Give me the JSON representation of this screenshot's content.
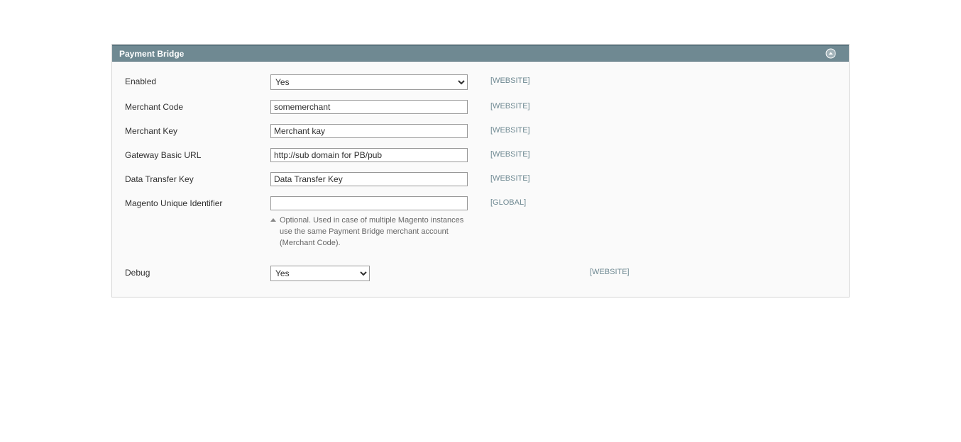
{
  "section": {
    "title": "Payment Bridge"
  },
  "fields": {
    "enabled": {
      "label": "Enabled",
      "value": "Yes",
      "scope": "[WEBSITE]"
    },
    "merchant_code": {
      "label": "Merchant Code",
      "value": "somemerchant",
      "scope": "[WEBSITE]"
    },
    "merchant_key": {
      "label": "Merchant Key",
      "value": "Merchant kay",
      "scope": "[WEBSITE]"
    },
    "gateway_url": {
      "label": "Gateway Basic URL",
      "value": "http://sub domain for PB/pub",
      "scope": "[WEBSITE]"
    },
    "data_transfer_key": {
      "label": "Data Transfer Key",
      "value": "Data Transfer Key",
      "scope": "[WEBSITE]"
    },
    "unique_id": {
      "label": "Magento Unique Identifier",
      "value": "",
      "scope": "[GLOBAL]",
      "note": "Optional. Used in case of multiple Magento instances use the same Payment Bridge merchant account (Merchant Code)."
    },
    "debug": {
      "label": "Debug",
      "value": "Yes",
      "scope": "[WEBSITE]"
    }
  }
}
